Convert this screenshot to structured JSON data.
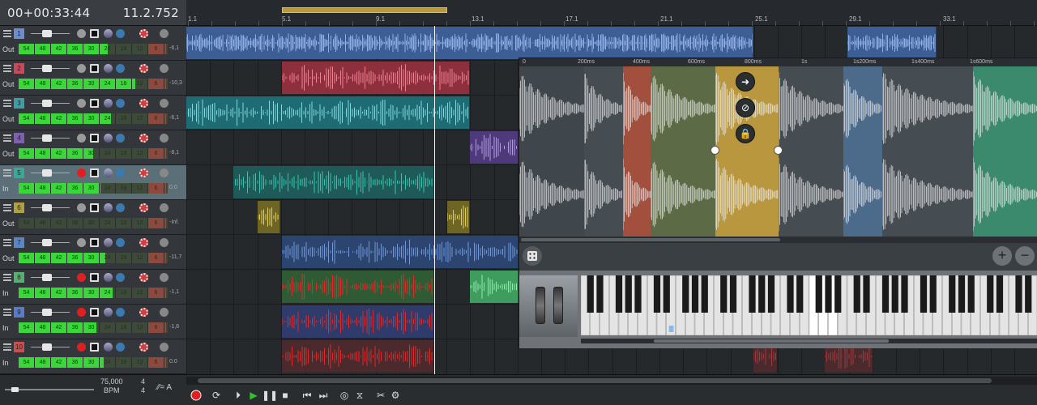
{
  "transport_display": {
    "time": "00+00:33:44",
    "position": "11.2.752"
  },
  "ruler": {
    "markers": [
      "1.1",
      "5.1",
      "9.1",
      "13.1",
      "17.1",
      "21.1",
      "25.1",
      "29.1",
      "33.1"
    ]
  },
  "tracks": [
    {
      "number": "1",
      "io": "Out",
      "level": "-6,1",
      "color": "#6f8ccc",
      "record": false,
      "selected": false
    },
    {
      "number": "2",
      "io": "Out",
      "level": "-10,3",
      "color": "#c84a5a",
      "record": false,
      "selected": false
    },
    {
      "number": "3",
      "io": "Out",
      "level": "-6,1",
      "color": "#3e9ea6",
      "record": false,
      "selected": false
    },
    {
      "number": "4",
      "io": "Out",
      "level": "-8,1",
      "color": "#7e5fb0",
      "record": false,
      "selected": false
    },
    {
      "number": "5",
      "io": "In",
      "level": "0.0",
      "color": "#38a898",
      "record": true,
      "selected": true
    },
    {
      "number": "6",
      "io": "Out",
      "level": "-Inf.",
      "color": "#b0a040",
      "record": false,
      "selected": false
    },
    {
      "number": "7",
      "io": "Out",
      "level": "-11,7",
      "color": "#5a86c8",
      "record": false,
      "selected": false
    },
    {
      "number": "8",
      "io": "In",
      "level": "-1,1",
      "color": "#58b070",
      "record": true,
      "selected": false
    },
    {
      "number": "9",
      "io": "In",
      "level": "-1,8",
      "color": "#5a7cc8",
      "record": true,
      "selected": false
    },
    {
      "number": "10",
      "io": "In",
      "level": "0.0",
      "color": "#c85050",
      "record": true,
      "selected": false
    }
  ],
  "meter_scale": [
    "54",
    "48",
    "42",
    "36",
    "30",
    "24",
    "18",
    "12",
    "6"
  ],
  "editor": {
    "ruler_labels": [
      "0",
      "200ms",
      "400ms",
      "600ms",
      "800ms",
      "1s",
      "1s200ms",
      "1s400ms",
      "1s600ms"
    ],
    "slice_buttons": [
      "arrow-right-icon",
      "unlink-icon",
      "lock-icon"
    ]
  },
  "footer": {
    "bpm_value": "75,000",
    "bpm_label": "BPM",
    "sig_top": "4",
    "sig_bottom": "4",
    "snap_label": "= A"
  },
  "colors": {
    "record": "#e02020",
    "play": "#30c030",
    "accent_loop": "#b89a3a"
  }
}
